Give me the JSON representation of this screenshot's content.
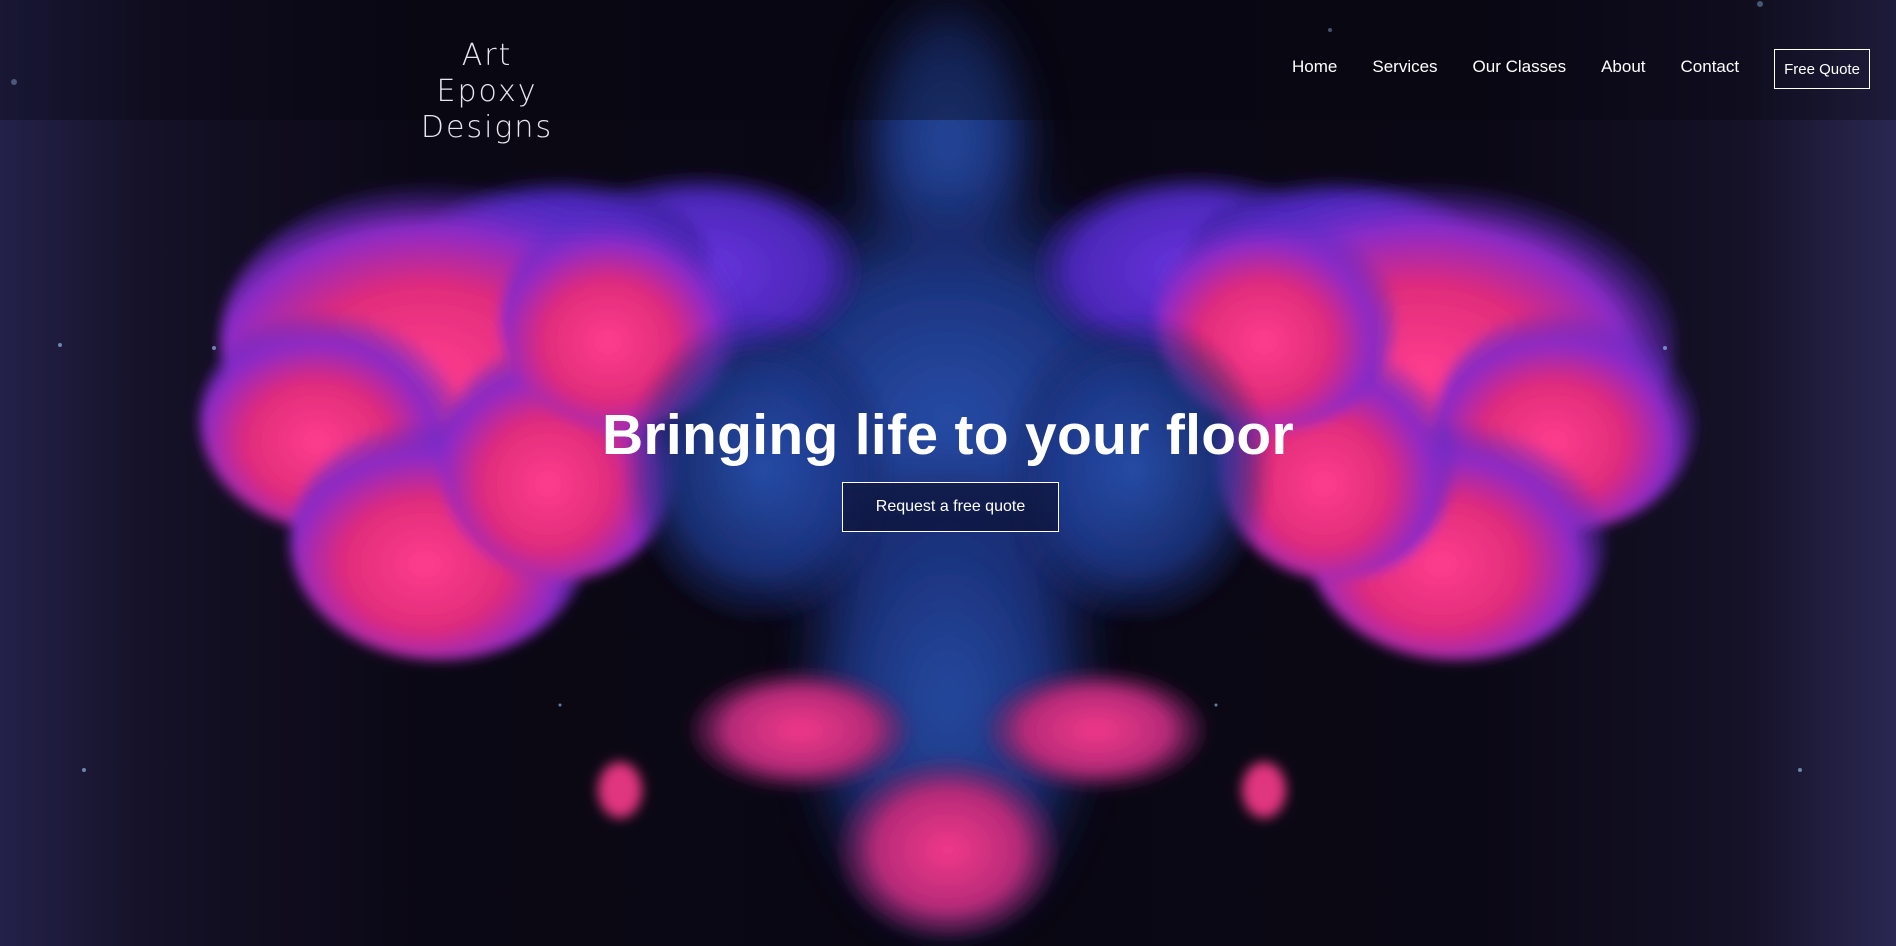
{
  "header": {
    "logo_line1": "Art Epoxy",
    "logo_line2": "Designs",
    "nav": [
      {
        "label": "Home"
      },
      {
        "label": "Services"
      },
      {
        "label": "Our Classes"
      },
      {
        "label": "About"
      },
      {
        "label": "Contact"
      }
    ],
    "cta_label": "Free Quote"
  },
  "hero": {
    "headline": "Bringing life to your floor",
    "button_label": "Request a free quote",
    "background_image": "symmetrical-pink-and-purple-ink-cloud"
  },
  "colors": {
    "ink_pink": "#e8307e",
    "ink_purple": "#5a2bd4",
    "ink_blue": "#1f3b8f",
    "background": "#0a0712",
    "text": "#ffffff"
  }
}
